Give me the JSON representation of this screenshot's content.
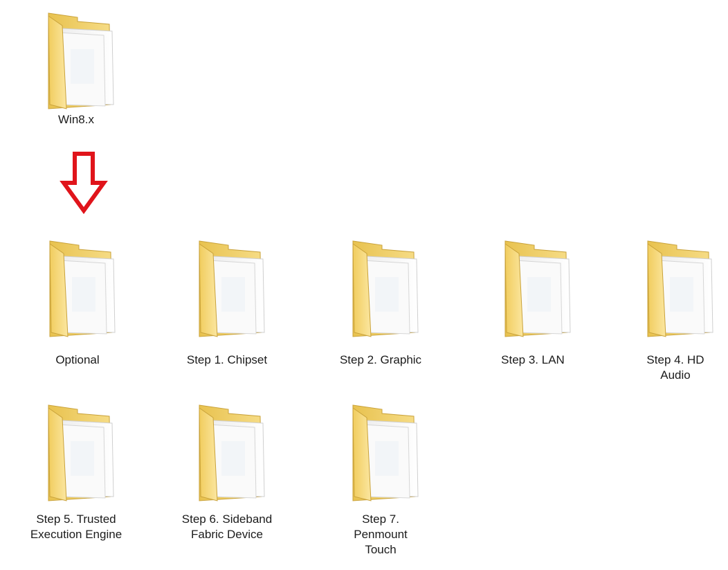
{
  "top_folder": {
    "label": "Win8.x",
    "icon": "folder-icon"
  },
  "arrow": {
    "icon": "down-arrow-icon",
    "color": "#e0141b"
  },
  "folders": [
    {
      "label": "Optional",
      "icon": "folder-icon"
    },
    {
      "label": "Step 1. Chipset",
      "icon": "folder-icon"
    },
    {
      "label": "Step 2. Graphic",
      "icon": "folder-icon"
    },
    {
      "label": "Step 3. LAN",
      "icon": "folder-icon"
    },
    {
      "label": "Step 4. HD Audio",
      "icon": "folder-icon"
    },
    {
      "label": "Step 5. Trusted Execution Engine",
      "icon": "folder-icon"
    },
    {
      "label": "Step 6. Sideband Fabric Device",
      "icon": "folder-icon"
    },
    {
      "label": "Step 7. Penmount Touch",
      "icon": "folder-icon"
    }
  ]
}
